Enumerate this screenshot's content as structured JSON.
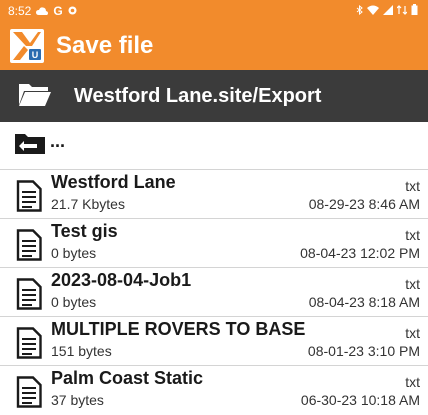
{
  "status_bar": {
    "time": "8:52",
    "left_icons": [
      "cloud-icon",
      "google-g-icon",
      "notification-dot-icon"
    ],
    "right_icons": [
      "bluetooth-icon",
      "wifi-icon",
      "signal-icon",
      "data-icon",
      "battery-icon"
    ]
  },
  "app_bar": {
    "logo_icon": "x-logo-icon",
    "title": "Save file"
  },
  "path_bar": {
    "folder_icon": "folder-open-icon",
    "path": "Westford Lane.site/Export"
  },
  "parent_folder": {
    "icon": "folder-up-icon",
    "label": "..."
  },
  "files": [
    {
      "name": "Westford Lane",
      "size": "21.7 Kbytes",
      "type": "txt",
      "date": "08-29-23 8:46 AM"
    },
    {
      "name": "Test gis",
      "size": "0 bytes",
      "type": "txt",
      "date": "08-04-23 12:02 PM"
    },
    {
      "name": "2023-08-04-Job1",
      "size": "0 bytes",
      "type": "txt",
      "date": "08-04-23 8:18 AM"
    },
    {
      "name": "MULTIPLE ROVERS TO BASE",
      "size": "151 bytes",
      "type": "txt",
      "date": "08-01-23 3:10 PM"
    },
    {
      "name": "Palm Coast Static",
      "size": "37 bytes",
      "type": "txt",
      "date": "06-30-23 10:18 AM"
    }
  ],
  "colors": {
    "accent": "#f28b2c",
    "path_bar_bg": "#3b3b3b",
    "divider": "#d4d4d4"
  }
}
